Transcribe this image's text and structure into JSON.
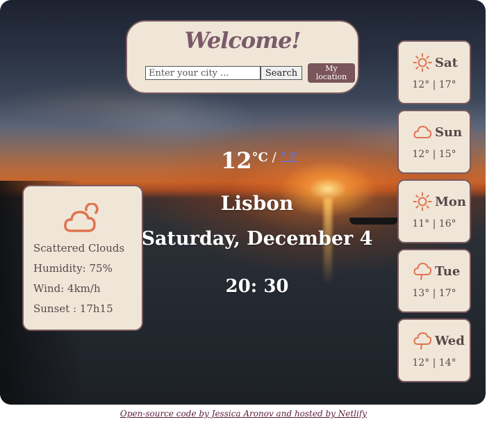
{
  "header": {
    "title": "Welcome!",
    "search_placeholder": "Enter your city ...",
    "search_label": "Search",
    "location_label_line1": "My",
    "location_label_line2": "location"
  },
  "current": {
    "temperature": "12",
    "unit_c": "°C",
    "unit_separator": " / ",
    "unit_f": "° F",
    "city": "Lisbon",
    "date": "Saturday, December 4",
    "time": "20: 30",
    "icon": "scattered-clouds-icon",
    "description": "Scattered Clouds",
    "humidity": "Humidity: 75%",
    "wind": "Wind: 4km/h",
    "sunset": "Sunset : 17h15"
  },
  "forecast": [
    {
      "day": "Sat",
      "temps": "12° | 17°",
      "icon": "sun-icon"
    },
    {
      "day": "Sun",
      "temps": "12° | 15°",
      "icon": "cloud-icon"
    },
    {
      "day": "Mon",
      "temps": "11° | 16°",
      "icon": "sun-icon"
    },
    {
      "day": "Tue",
      "temps": "13° | 17°",
      "icon": "rain-cloud-icon"
    },
    {
      "day": "Wed",
      "temps": "12° | 14°",
      "icon": "rain-cloud-icon"
    }
  ],
  "footer": {
    "text": "Open-source code by Jessica Aronov and hosted by Netlify"
  },
  "colors": {
    "card_background": "#efe6d8",
    "card_border": "#7a5a5e",
    "icon_accent": "#e0734f",
    "button_location": "#7a555a",
    "footer_link": "#5a1a3a"
  }
}
